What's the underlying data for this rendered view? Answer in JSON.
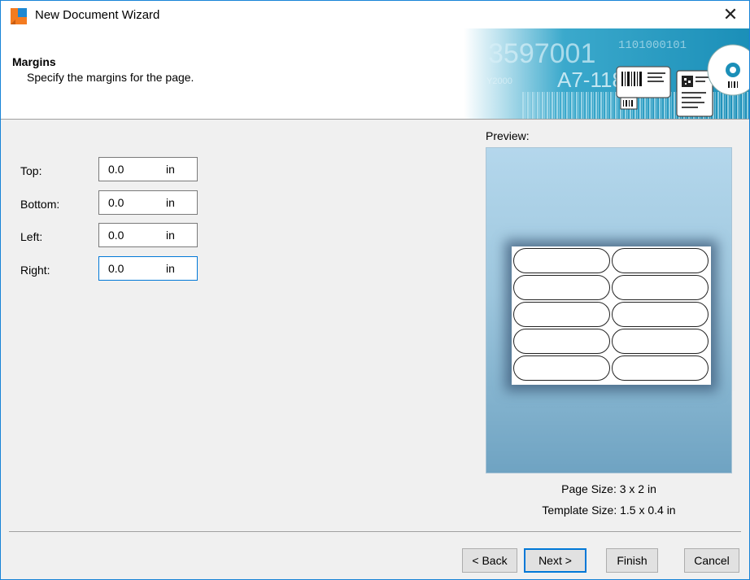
{
  "window": {
    "title": "New Document Wizard",
    "close_glyph": "✕"
  },
  "header": {
    "title": "Margins",
    "subtitle": "Specify the margins for the page."
  },
  "banner": {
    "digits": "3597001",
    "code": "A7-118",
    "year": "Y2000",
    "bits": "1101000101"
  },
  "form": {
    "fields": [
      {
        "label": "Top:",
        "value": "0.0",
        "unit": "in"
      },
      {
        "label": "Bottom:",
        "value": "0.0",
        "unit": "in"
      },
      {
        "label": "Left:",
        "value": "0.0",
        "unit": "in"
      },
      {
        "label": "Right:",
        "value": "0.0",
        "unit": "in"
      }
    ]
  },
  "preview": {
    "label": "Preview:",
    "page_size": "Page Size:  3 x 2 in",
    "template_size": "Template Size:  1.5 x 0.4 in"
  },
  "buttons": {
    "back": "< Back",
    "next": "Next >",
    "finish": "Finish",
    "cancel": "Cancel"
  },
  "colors": {
    "accent": "#0078d7",
    "preview_top": "#b4d7ec",
    "preview_bottom": "#6fa3c2",
    "banner": "#1f9fc4"
  }
}
